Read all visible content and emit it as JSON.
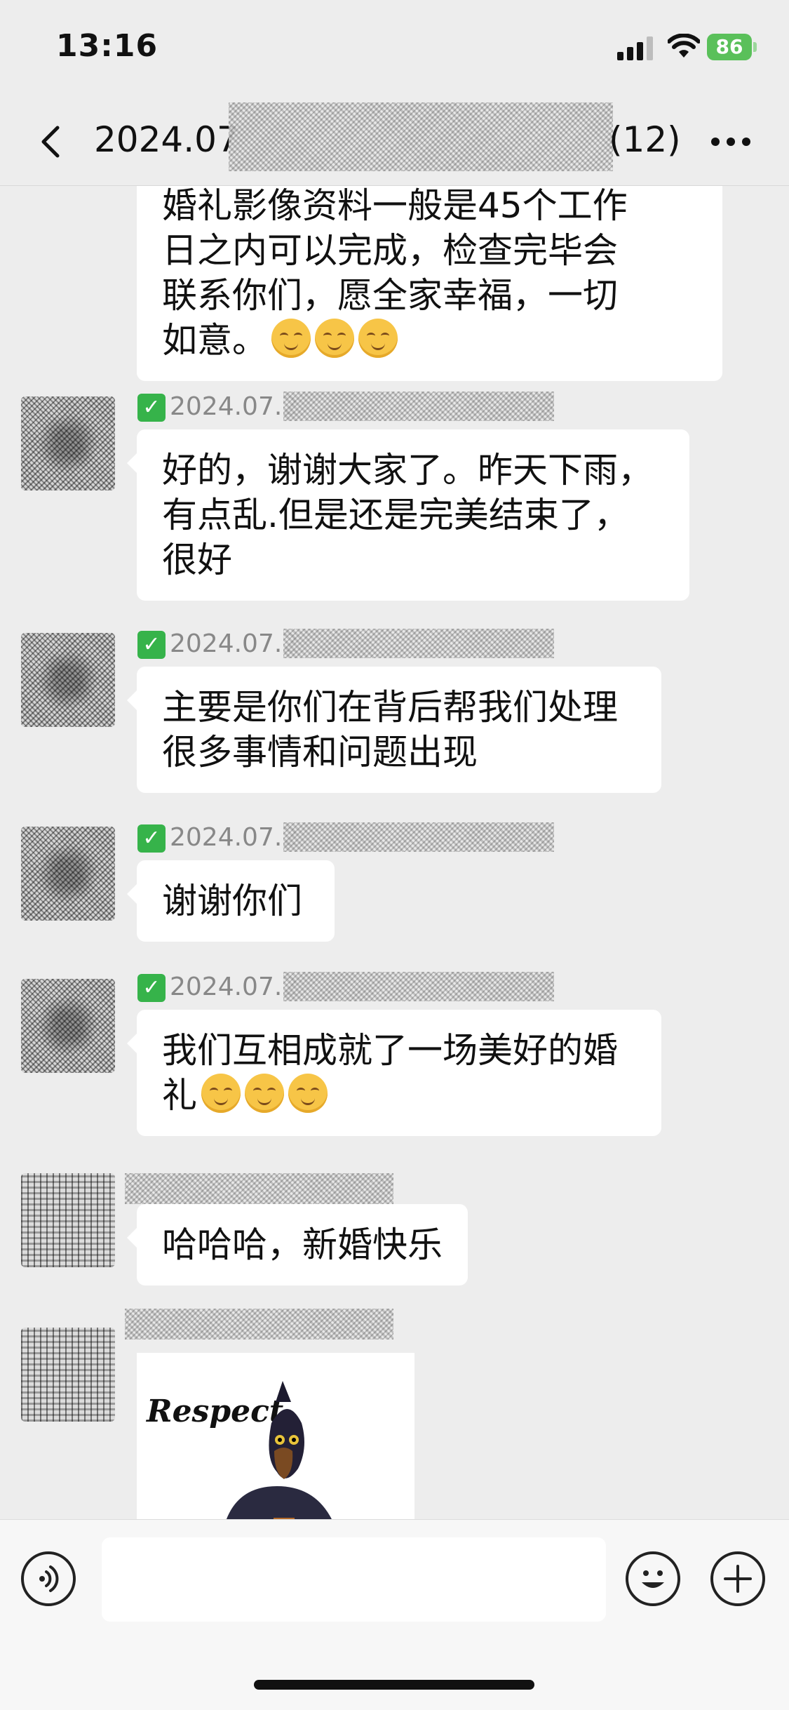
{
  "status_bar": {
    "time": "13:16",
    "battery": "86"
  },
  "nav": {
    "title_prefix": "2024.07",
    "title_suffix": "(12)"
  },
  "messages": [
    {
      "text_lines": [
        "婚礼影像资料一般是45个工作",
        "日之内可以完成，检查完毕会",
        "联系你们，愿全家幸福，一切",
        "如意。"
      ],
      "emoji_count": 3
    },
    {
      "sender_prefix": "2024.07.2",
      "text_lines": [
        "好的，谢谢大家了。昨天下雨，",
        "有点乱.但是还是完美结束了，",
        "很好"
      ]
    },
    {
      "sender_prefix": "2024.07.2",
      "text_lines": [
        "主要是你们在背后帮我们处理",
        "很多事情和问题出现"
      ]
    },
    {
      "sender_prefix": "2024.07.2",
      "text_lines": [
        "谢谢你们"
      ]
    },
    {
      "sender_prefix": "2024.07.2",
      "text_lines": [
        "我们互相成就了一场美好的婚",
        "礼"
      ],
      "emoji_count": 3
    },
    {
      "text_lines": [
        "哈哈哈，新婚快乐"
      ]
    },
    {
      "sticker_text": "Respect"
    }
  ],
  "icons": {
    "back": "chevron-left-icon",
    "more": "more-dots-icon",
    "voice": "voice-icon",
    "emoji": "emoji-icon",
    "plus": "plus-icon"
  }
}
